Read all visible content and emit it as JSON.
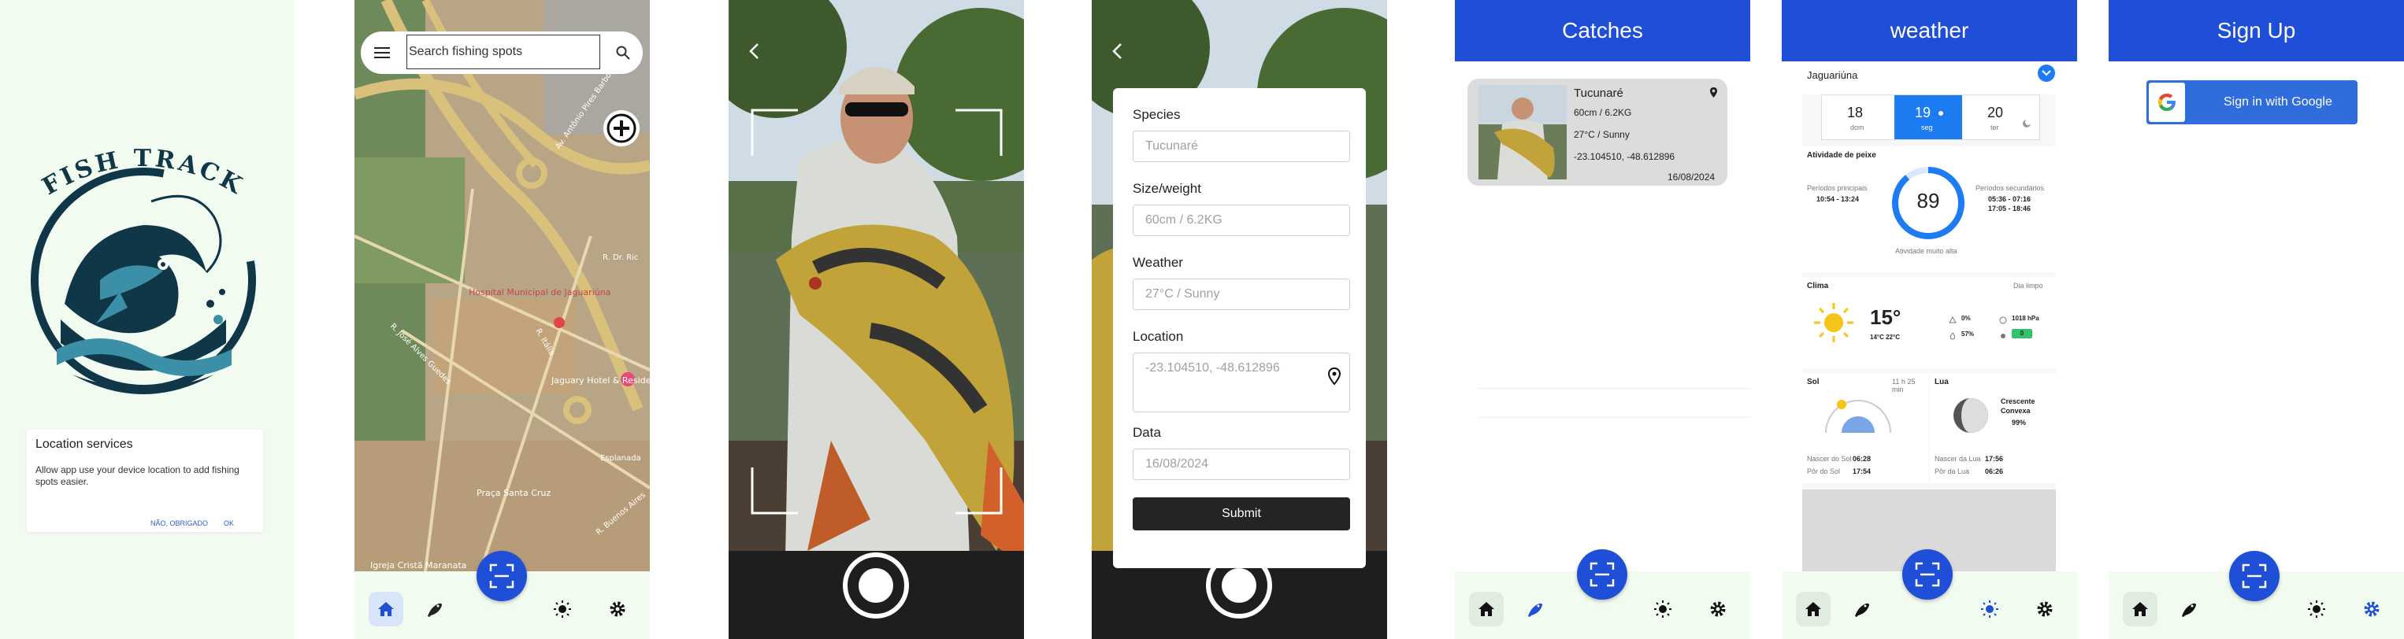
{
  "splash": {
    "logo_text": "FISH TRACK",
    "dialog_title": "Location services",
    "dialog_body": "Allow app use your device location to add fishing spots easier.",
    "dialog_decline": "NÃO, OBRIGADO",
    "dialog_ok": "OK"
  },
  "map": {
    "search_placeholder": "Search fishing spots",
    "labels": {
      "hospital": "Hospital Municipal de Jaguariúna",
      "hotel": "Jaguary Hotel & Residence",
      "praca": "Praça Santa Cruz",
      "igreja": "Igreja Cristã Maranata",
      "rua_jose": "R. José Alves Guedes",
      "rua_ric": "R. Dr. Ric",
      "rua_ita": "R. Itália",
      "rua_ant": "Av. Antônio Pires Barbosa",
      "rua_esp": "Esplanada",
      "rua_bue": "R. Buenos Aires"
    }
  },
  "catch_form": {
    "species_label": "Species",
    "species_placeholder": "Tucunaré",
    "size_label": "Size/weight",
    "size_placeholder": "60cm  /  6.2KG",
    "weather_label": "Weather",
    "weather_placeholder": "27°C  /  Sunny",
    "location_label": "Location",
    "location_placeholder": "-23.104510, -48.612896",
    "date_label": "Data",
    "date_placeholder": "16/08/2024",
    "submit_label": "Submit"
  },
  "catches": {
    "title": "Catches",
    "item": {
      "species": "Tucunaré",
      "size": "60cm / 6.2KG",
      "weather": "27°C / Sunny",
      "location": "-23.104510, -48.612896",
      "date": "16/08/2024"
    }
  },
  "weather": {
    "title": "weather",
    "city": "Jaguariúna",
    "days": [
      {
        "num": "18",
        "name": "dom",
        "selected": false
      },
      {
        "num": "19",
        "name": "seg",
        "selected": true
      },
      {
        "num": "20",
        "name": "ter",
        "selected": false
      }
    ],
    "activity_title": "Atividade de peixe",
    "periods_main_label": "Períodos principais",
    "periods_main_value": "10:54 - 13:24",
    "periods_secondary_label": "Períodos secundários",
    "periods_secondary_value1": "05:36 - 07:16",
    "periods_secondary_value2": "17:05 - 18:46",
    "activity_score": "89",
    "activity_caption": "Atividade muito alta",
    "clima_title": "Clima",
    "clima_summary": "Dia limpo",
    "temp": "15°",
    "temp_range": "14°C 22°C",
    "rain_pct": "0%",
    "humidity_pct": "57%",
    "pressure": "1018 hPa",
    "uv": "0",
    "sol_title": "Sol",
    "sol_duration": "11 h 25 min",
    "sunrise_label": "Nascer do Sol",
    "sunrise": "06:28",
    "sunset_label": "Pôr do Sol",
    "sunset": "17:54",
    "lua_title": "Lua",
    "moon_phase": "Crescente Convexa",
    "moon_pct": "99%",
    "moonrise_label": "Nascer da Lua",
    "moonrise": "17:56",
    "moonset_label": "Pôr da Lua",
    "moonset": "06:26"
  },
  "signup": {
    "title": "Sign Up",
    "google_button": "Sign in with Google"
  },
  "colors": {
    "primary": "#1e4fd6",
    "nav_bg": "#f1fbef",
    "logo_dark": "#0f3748"
  }
}
